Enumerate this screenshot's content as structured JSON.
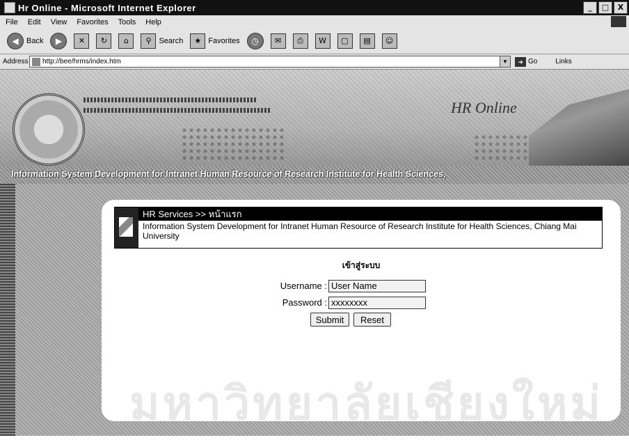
{
  "window": {
    "title": "Hr Online - Microsoft Internet Explorer",
    "controls": [
      "_",
      "□",
      "X"
    ]
  },
  "menu": [
    "File",
    "Edit",
    "View",
    "Favorites",
    "Tools",
    "Help"
  ],
  "toolbar": {
    "back": "Back",
    "search": "Search",
    "favorites": "Favorites"
  },
  "address": {
    "label": "Address",
    "url": "http://bee/hrms/index.htm",
    "go": "Go",
    "links": "Links"
  },
  "banner": {
    "site_name": "HR Online",
    "tagline": "Information System Development for Intranet Human Resource of Research Institute for Health Sciences,"
  },
  "service": {
    "title": "HR Services >> หน้าแรก",
    "description": "Information System Development for Intranet Human Resource of Research Institute for Health Sciences, Chiang Mai University"
  },
  "login": {
    "heading": "เข้าสู่ระบบ",
    "username_label": "Username :",
    "username_value": "User Name",
    "password_label": "Password :",
    "password_value": "xxxxxxxx",
    "submit": "Submit",
    "reset": "Reset"
  }
}
